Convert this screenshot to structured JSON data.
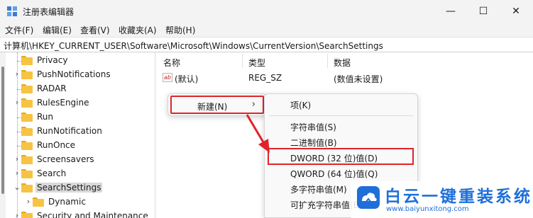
{
  "window": {
    "title": "注册表编辑器",
    "minimize_glyph": "—",
    "maximize_glyph": "☐",
    "close_glyph": "✕"
  },
  "menu": [
    "文件(F)",
    "编辑(E)",
    "查看(V)",
    "收藏夹(A)",
    "帮助(H)"
  ],
  "address": "计算机\\HKEY_CURRENT_USER\\Software\\Microsoft\\Windows\\CurrentVersion\\SearchSettings",
  "tree": {
    "items": [
      {
        "label": "Privacy",
        "expandable": false
      },
      {
        "label": "PushNotifications",
        "expandable": true
      },
      {
        "label": "RADAR",
        "expandable": false
      },
      {
        "label": "RulesEngine",
        "expandable": true
      },
      {
        "label": "Run",
        "expandable": false
      },
      {
        "label": "RunNotification",
        "expandable": false
      },
      {
        "label": "RunOnce",
        "expandable": false
      },
      {
        "label": "Screensavers",
        "expandable": true
      },
      {
        "label": "Search",
        "expandable": true
      },
      {
        "label": "SearchSettings",
        "expandable": true,
        "expanded": true,
        "selected": true
      },
      {
        "label": "Dynamic",
        "expandable": true,
        "child": true
      },
      {
        "label": "Security and Maintenance",
        "expandable": true
      }
    ]
  },
  "list": {
    "columns": [
      "名称",
      "类型",
      "数据"
    ],
    "rows": [
      {
        "icon": "ab",
        "name": "(默认)",
        "type": "REG_SZ",
        "data": "(数值未设置)"
      }
    ]
  },
  "context_menu": {
    "new_label": "新建(N)",
    "new_arrow": "›"
  },
  "submenu": {
    "key": "项(K)",
    "items": [
      "字符串值(S)",
      "二进制值(B)",
      "DWORD (32 位)值(D)",
      "QWORD (64 位)值(Q)",
      "多字符串值(M)",
      "可扩充字符串值(E)"
    ]
  },
  "watermark": {
    "title": "白云一键重装系统",
    "url": "www.baiyunxitong.com"
  },
  "colors": {
    "highlight_red": "#e0232b",
    "folder_yellow": "#f6c343",
    "watermark_blue": "#1e6fd9"
  }
}
